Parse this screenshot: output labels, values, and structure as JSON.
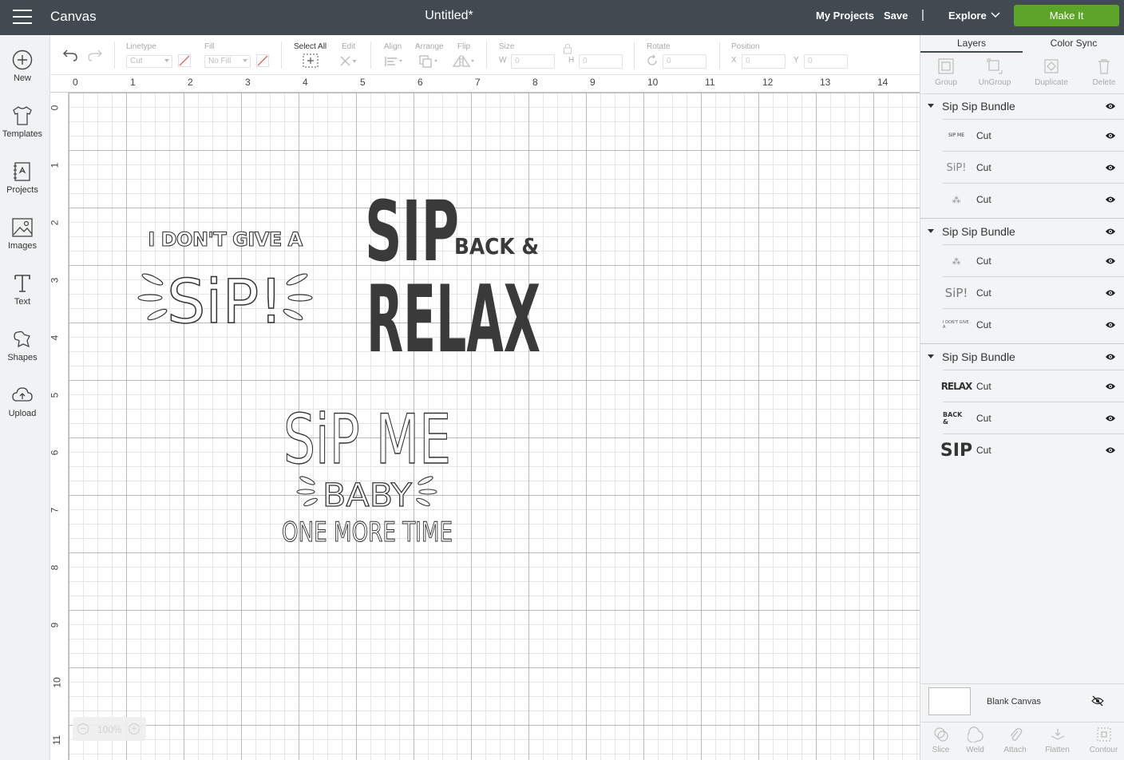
{
  "header": {
    "app_title": "Canvas",
    "document_title": "Untitled*",
    "my_projects": "My Projects",
    "save": "Save",
    "separator": "|",
    "explore": "Explore",
    "make_it": "Make It"
  },
  "leftbar": {
    "new": "New",
    "templates": "Templates",
    "projects": "Projects",
    "images": "Images",
    "text": "Text",
    "shapes": "Shapes",
    "upload": "Upload"
  },
  "toolbar": {
    "linetype_label": "Linetype",
    "linetype_value": "Cut",
    "fill_label": "Fill",
    "fill_value": "No Fill",
    "select_all": "Select All",
    "edit": "Edit",
    "align": "Align",
    "arrange": "Arrange",
    "flip": "Flip",
    "size": "Size",
    "w": "W",
    "w_value": "0",
    "h": "H",
    "h_value": "0",
    "rotate": "Rotate",
    "rotate_value": "0",
    "position": "Position",
    "x": "X",
    "x_value": "0",
    "y": "Y",
    "y_value": "0"
  },
  "ruler": {
    "x_ticks": [
      "0",
      "1",
      "2",
      "3",
      "4",
      "5",
      "6",
      "7",
      "8",
      "9",
      "10",
      "11",
      "12",
      "13",
      "14"
    ],
    "y_ticks": [
      "0",
      "1",
      "2",
      "3",
      "4",
      "5",
      "6",
      "7",
      "8",
      "9",
      "10",
      "11"
    ]
  },
  "canvas": {
    "design1": {
      "line1": "I DON'T GIVE A",
      "line2": "SiP!"
    },
    "design2": {
      "line1": "SIP",
      "line2": "BACK &",
      "line3": "RELAX"
    },
    "design3": {
      "line1": "SiP ME",
      "line2": "BABY",
      "line3": "ONE MORE TIME"
    },
    "zoom": "100%",
    "zoom_minus": "−",
    "zoom_plus": "+"
  },
  "panel": {
    "tabs": [
      "Layers",
      "Color Sync"
    ],
    "actions": [
      "Group",
      "UnGroup",
      "Duplicate",
      "Delete"
    ],
    "groups": [
      {
        "name": "Sip Sip Bundle",
        "layers": [
          {
            "thumb": "SIP ME",
            "label": "Cut"
          },
          {
            "thumb": "SiP!",
            "label": "Cut"
          },
          {
            "thumb": "⁂",
            "label": "Cut"
          }
        ]
      },
      {
        "name": "Sip Sip Bundle",
        "layers": [
          {
            "thumb": "⁂",
            "label": "Cut"
          },
          {
            "thumb": "SiP!",
            "label": "Cut"
          },
          {
            "thumb": "I DON'T GIVE A",
            "label": "Cut"
          }
        ]
      },
      {
        "name": "Sip Sip Bundle",
        "layers": [
          {
            "thumb": "RELAX",
            "label": "Cut"
          },
          {
            "thumb": "BACK &",
            "label": "Cut"
          },
          {
            "thumb": "SIP",
            "label": "Cut"
          }
        ]
      }
    ],
    "blank_canvas": "Blank Canvas",
    "bottom_actions": [
      "Slice",
      "Weld",
      "Attach",
      "Flatten",
      "Contour"
    ]
  }
}
